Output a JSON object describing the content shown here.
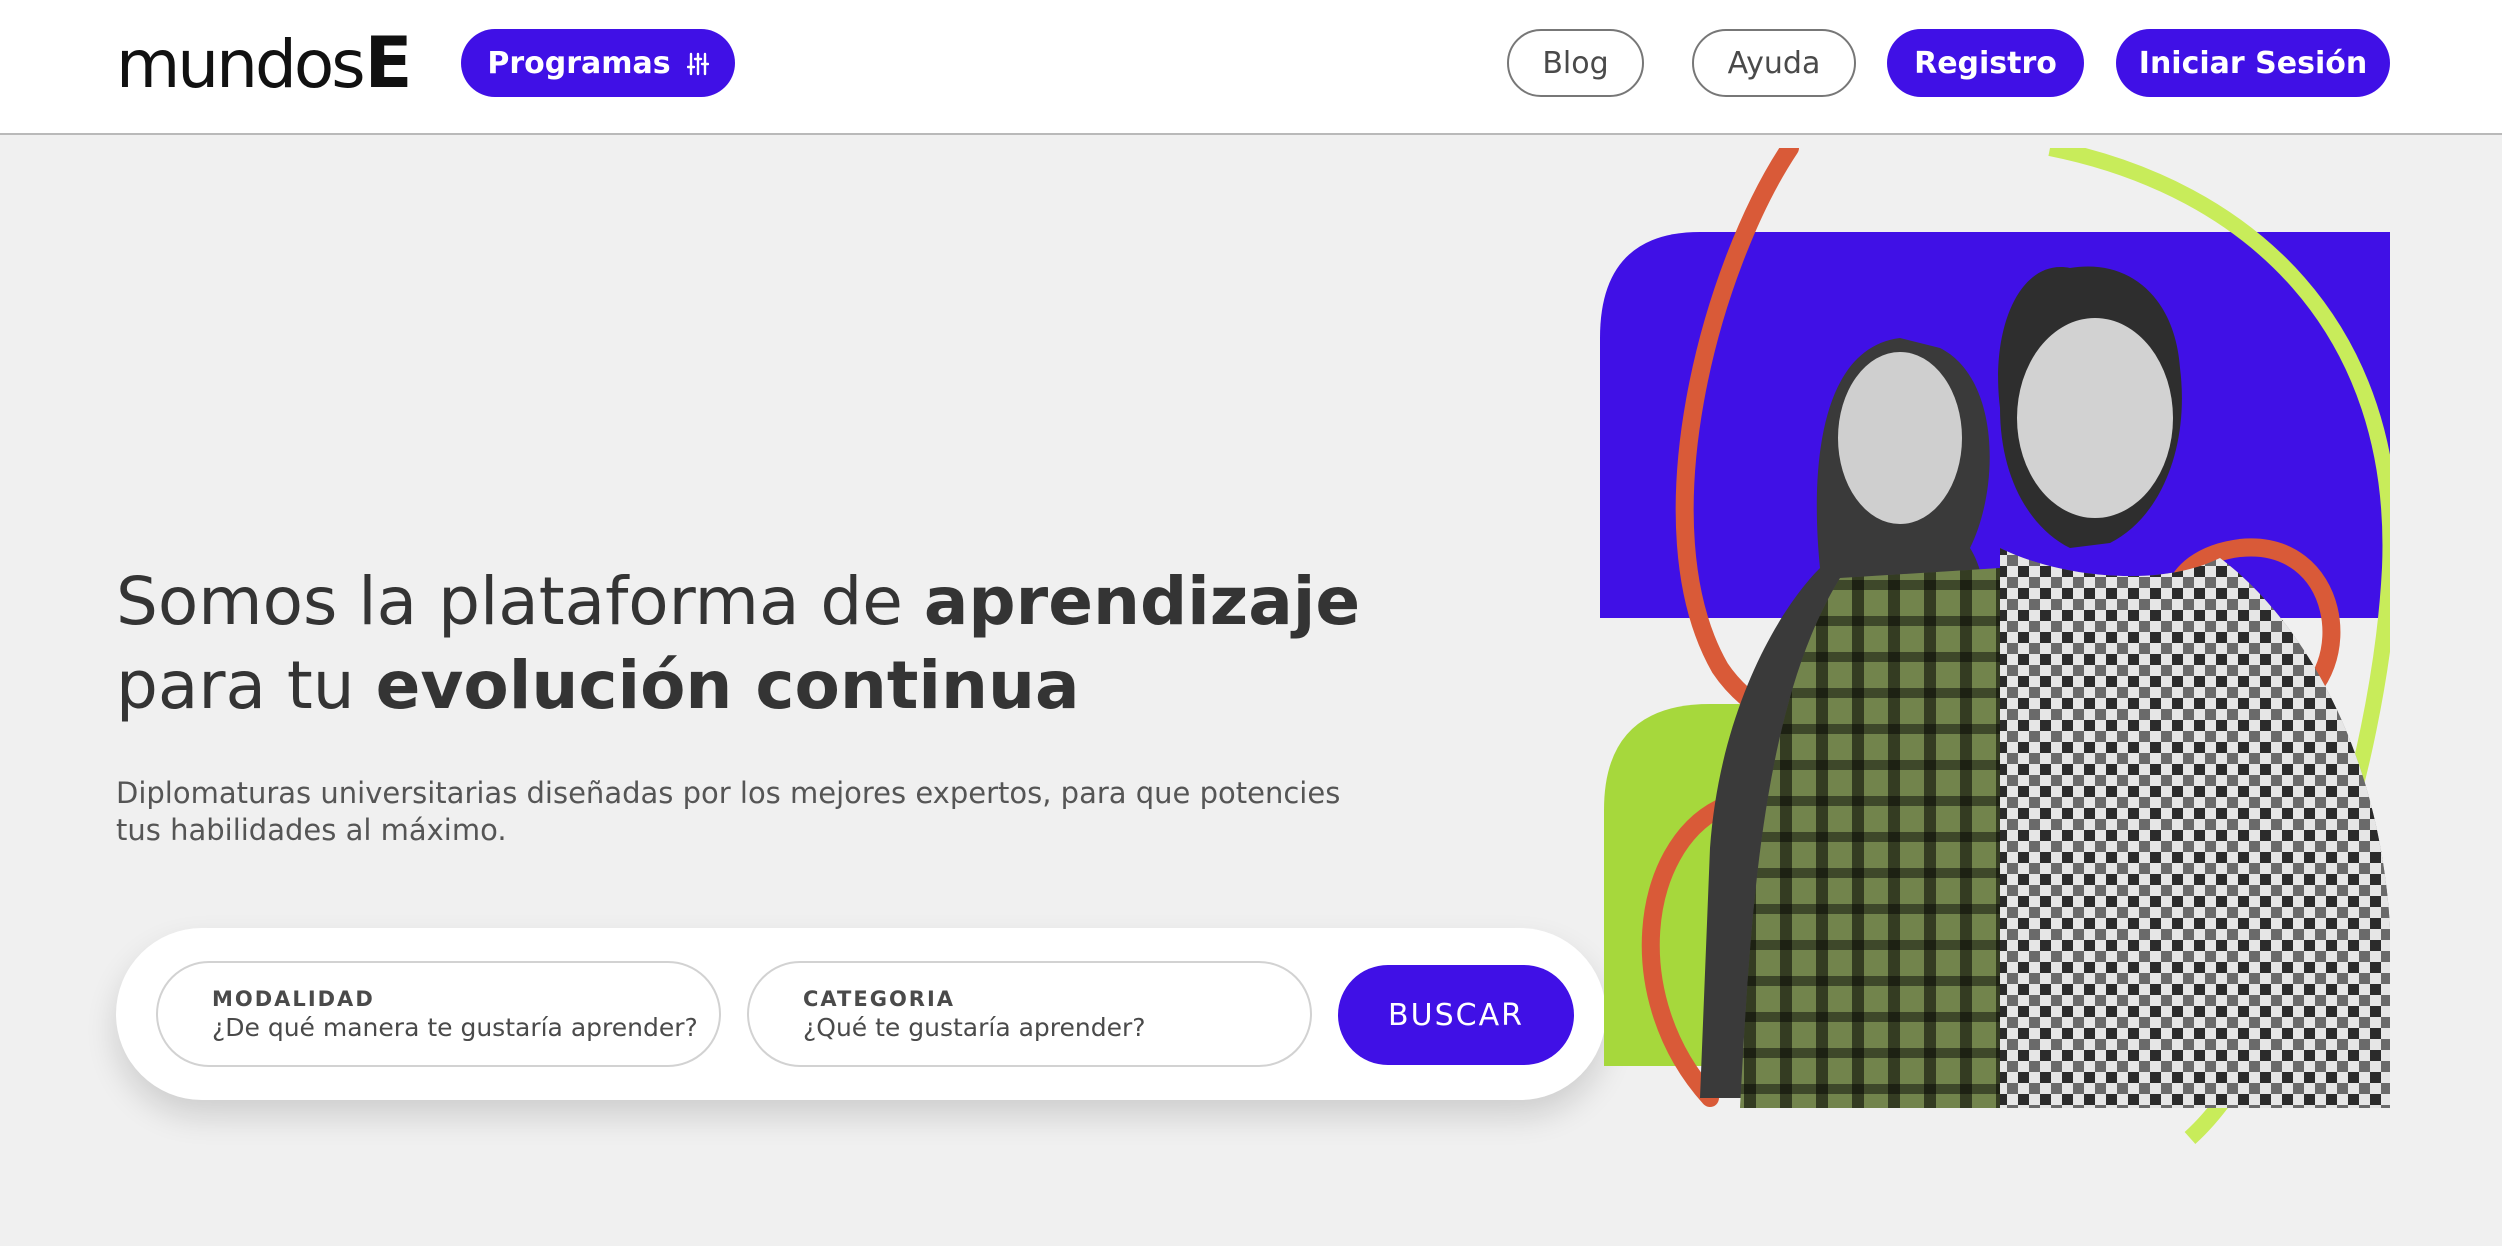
{
  "header": {
    "logo_text": "mundos",
    "logo_mark": "E",
    "programas_label": "Programas",
    "programas_icon": "sliders-icon",
    "blog_label": "Blog",
    "ayuda_label": "Ayuda",
    "registro_label": "Registro",
    "login_label": "Iniciar Sesión"
  },
  "hero": {
    "title_1": "Somos la plataforma de ",
    "title_1_strong": "aprendizaje",
    "title_2": "para tu ",
    "title_2_strong": "evolución continua",
    "subtitle": "Diplomaturas universitarias diseñadas por los mejores expertos, para que potencies tus habilidades al máximo."
  },
  "search": {
    "modalidad_label": "MODALIDAD",
    "modalidad_value": "¿De qué manera te gustaría aprender?",
    "categoria_label": "CATEGORIA",
    "categoria_value": "¿Qué te gustaría aprender?",
    "button_label": "BUSCAR"
  },
  "colors": {
    "brand": "#4010e6",
    "lime": "#a6d83c",
    "orange": "#d95a38",
    "background": "#f0f0f0"
  }
}
